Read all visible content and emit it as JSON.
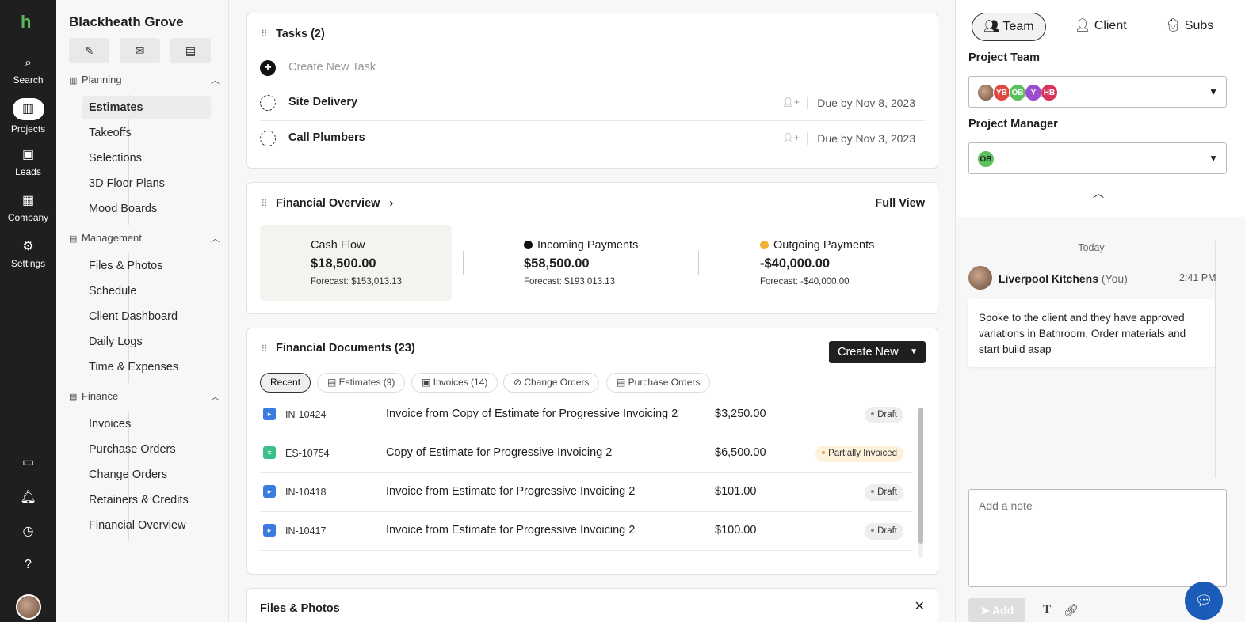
{
  "rail": {
    "logo": "h",
    "items": [
      {
        "label": "Search",
        "icon": "search-icon",
        "glyph": "🔍"
      },
      {
        "label": "Projects",
        "icon": "projects-icon",
        "glyph": "▥"
      },
      {
        "label": "Leads",
        "icon": "leads-icon",
        "glyph": "▣"
      },
      {
        "label": "Company",
        "icon": "company-icon",
        "glyph": "▦"
      },
      {
        "label": "Settings",
        "icon": "gear-icon",
        "glyph": "⚙"
      }
    ]
  },
  "nav": {
    "project_name": "Blackheath Grove",
    "sections": [
      {
        "title": "Planning",
        "items": [
          "Estimates",
          "Takeoffs",
          "Selections",
          "3D Floor Plans",
          "Mood Boards"
        ]
      },
      {
        "title": "Management",
        "items": [
          "Files & Photos",
          "Schedule",
          "Client Dashboard",
          "Daily Logs",
          "Time & Expenses"
        ]
      },
      {
        "title": "Finance",
        "items": [
          "Invoices",
          "Purchase Orders",
          "Change Orders",
          "Retainers & Credits",
          "Financial Overview"
        ]
      }
    ],
    "active_item": "Estimates"
  },
  "tasks": {
    "title": "Tasks (2)",
    "create_placeholder": "Create New Task",
    "items": [
      {
        "name": "Site Delivery",
        "due": "Due by Nov 8, 2023"
      },
      {
        "name": "Call Plumbers",
        "due": "Due by Nov 3, 2023"
      }
    ]
  },
  "financial_overview": {
    "title": "Financial Overview",
    "full_view": "Full View",
    "cash_flow": {
      "label": "Cash Flow",
      "amount": "$18,500.00",
      "forecast": "Forecast: $153,013.13"
    },
    "incoming": {
      "label": "Incoming Payments",
      "amount": "$58,500.00",
      "forecast": "Forecast: $193,013.13",
      "color": "#111111"
    },
    "outgoing": {
      "label": "Outgoing Payments",
      "amount": "-$40,000.00",
      "forecast": "Forecast: -$40,000.00",
      "color": "#f2b233"
    }
  },
  "financial_documents": {
    "title": "Financial Documents (23)",
    "create_new": "Create New",
    "chips": [
      "Recent",
      "Estimates (9)",
      "Invoices (14)",
      "Change Orders",
      "Purchase Orders"
    ],
    "rows": [
      {
        "number": "IN-10424",
        "name": "Invoice from Copy of Estimate for Progressive Invoicing 2",
        "amount": "$3,250.00",
        "status": "Draft",
        "kind": "invoice"
      },
      {
        "number": "ES-10754",
        "name": "Copy of Estimate for Progressive Invoicing 2",
        "amount": "$6,500.00",
        "status": "Partially Invoiced",
        "kind": "estimate"
      },
      {
        "number": "IN-10418",
        "name": "Invoice from Estimate for Progressive Invoicing 2",
        "amount": "$101.00",
        "status": "Draft",
        "kind": "invoice"
      },
      {
        "number": "IN-10417",
        "name": "Invoice from Estimate for Progressive Invoicing 2",
        "amount": "$100.00",
        "status": "Draft",
        "kind": "invoice"
      }
    ]
  },
  "files_photos": {
    "title": "Files & Photos"
  },
  "right_panel": {
    "tabs": [
      "Team",
      "Client",
      "Subs"
    ],
    "active_tab": "Team",
    "project_team_label": "Project Team",
    "team_avatars": [
      {
        "initials": "",
        "color": "#8a6a55"
      },
      {
        "initials": "YB",
        "color": "#e0483f"
      },
      {
        "initials": "OB",
        "color": "#5cc05c"
      },
      {
        "initials": "Y",
        "color": "#9b4fd0"
      },
      {
        "initials": "HB",
        "color": "#d6335a"
      }
    ],
    "project_manager_label": "Project Manager",
    "manager_avatar": {
      "initials": "OB",
      "color": "#5cc05c"
    },
    "feed": {
      "day": "Today",
      "author": "Liverpool Kitchens",
      "author_suffix": "(You)",
      "time": "2:41 PM",
      "body": "Spoke to the client and they have approved variations in Bathroom. Order materials and start build asap"
    },
    "note_placeholder": "Add a note",
    "add_label": "Add"
  }
}
